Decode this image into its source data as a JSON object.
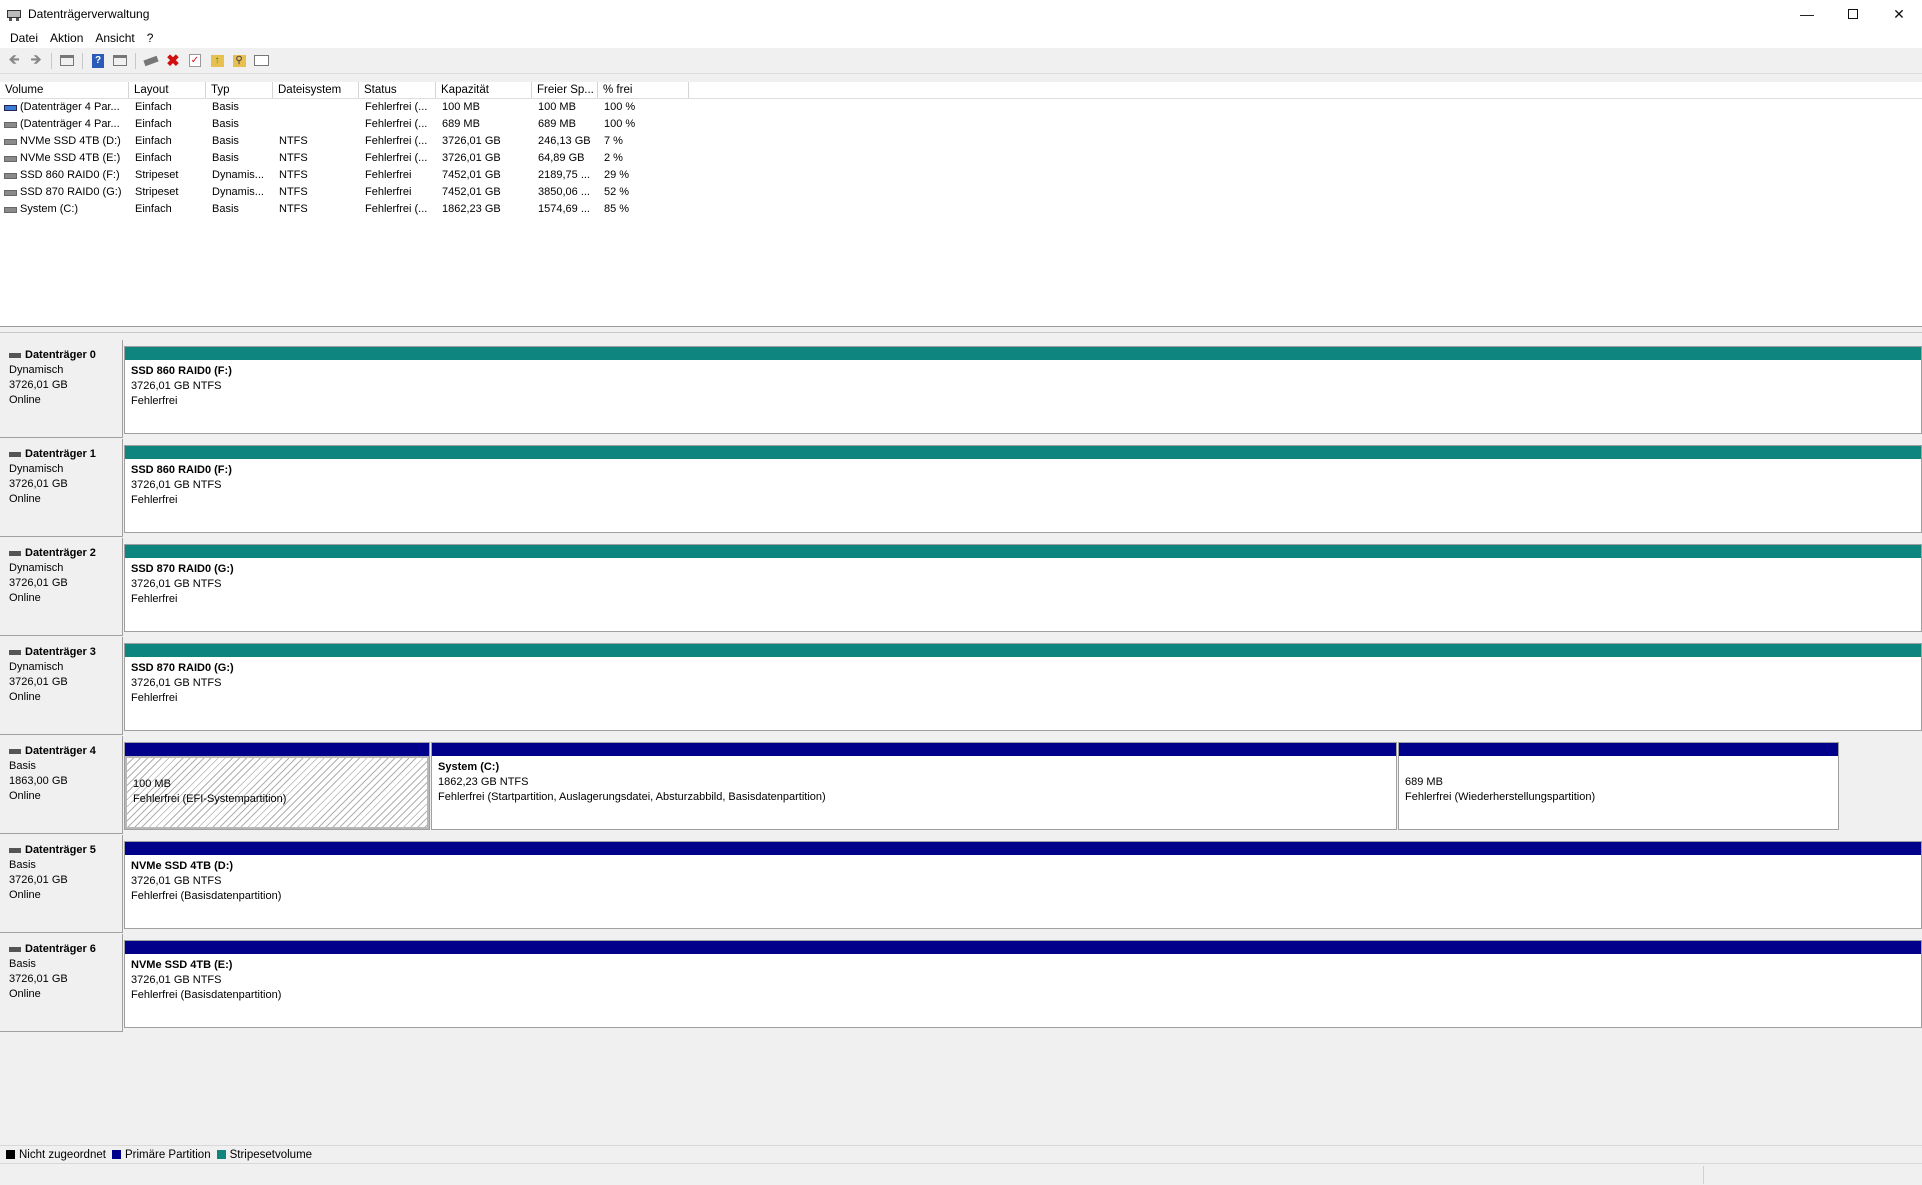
{
  "window": {
    "title": "Datenträgerverwaltung"
  },
  "menu": [
    "Datei",
    "Aktion",
    "Ansicht",
    "?"
  ],
  "toolbar_icons": [
    "back-arrow-icon",
    "forward-arrow-icon",
    "console-tree-icon",
    "help-icon",
    "properties-icon",
    "connect-disk-icon",
    "delete-icon",
    "check-icon",
    "folder-up-icon",
    "search-icon",
    "disk-list-icon"
  ],
  "volume_table": {
    "columns": [
      "Volume",
      "Layout",
      "Typ",
      "Dateisystem",
      "Status",
      "Kapazität",
      "Freier Sp...",
      "% frei"
    ],
    "rows": [
      {
        "icon": "blue",
        "cells": [
          "(Datenträger 4 Par...",
          "Einfach",
          "Basis",
          "",
          "Fehlerfrei (...",
          "100 MB",
          "100 MB",
          "100 %"
        ]
      },
      {
        "icon": "gray",
        "cells": [
          "(Datenträger 4 Par...",
          "Einfach",
          "Basis",
          "",
          "Fehlerfrei (...",
          "689 MB",
          "689 MB",
          "100 %"
        ]
      },
      {
        "icon": "gray",
        "cells": [
          "NVMe SSD 4TB (D:)",
          "Einfach",
          "Basis",
          "NTFS",
          "Fehlerfrei (...",
          "3726,01 GB",
          "246,13 GB",
          "7 %"
        ]
      },
      {
        "icon": "gray",
        "cells": [
          "NVMe SSD 4TB (E:)",
          "Einfach",
          "Basis",
          "NTFS",
          "Fehlerfrei (...",
          "3726,01 GB",
          "64,89 GB",
          "2 %"
        ]
      },
      {
        "icon": "gray",
        "cells": [
          "SSD 860 RAID0 (F:)",
          "Stripeset",
          "Dynamis...",
          "NTFS",
          "Fehlerfrei",
          "7452,01 GB",
          "2189,75 ...",
          "29 %"
        ]
      },
      {
        "icon": "gray",
        "cells": [
          "SSD 870 RAID0 (G:)",
          "Stripeset",
          "Dynamis...",
          "NTFS",
          "Fehlerfrei",
          "7452,01 GB",
          "3850,06 ...",
          "52 %"
        ]
      },
      {
        "icon": "gray",
        "cells": [
          "System (C:)",
          "Einfach",
          "Basis",
          "NTFS",
          "Fehlerfrei (...",
          "1862,23 GB",
          "1574,69 ...",
          "85 %"
        ]
      }
    ]
  },
  "disks": [
    {
      "name": "Datenträger 0",
      "type": "Dynamisch",
      "size": "3726,01 GB",
      "state": "Online",
      "partitions": [
        {
          "style": "teal",
          "label": "SSD 860 RAID0  (F:)",
          "size": "3726,01 GB NTFS",
          "status": "Fehlerfrei"
        }
      ]
    },
    {
      "name": "Datenträger 1",
      "type": "Dynamisch",
      "size": "3726,01 GB",
      "state": "Online",
      "partitions": [
        {
          "style": "teal",
          "label": "SSD 860 RAID0  (F:)",
          "size": "3726,01 GB NTFS",
          "status": "Fehlerfrei"
        }
      ]
    },
    {
      "name": "Datenträger 2",
      "type": "Dynamisch",
      "size": "3726,01 GB",
      "state": "Online",
      "partitions": [
        {
          "style": "teal",
          "label": "SSD 870 RAID0  (G:)",
          "size": "3726,01 GB NTFS",
          "status": "Fehlerfrei"
        }
      ]
    },
    {
      "name": "Datenträger 3",
      "type": "Dynamisch",
      "size": "3726,01 GB",
      "state": "Online",
      "partitions": [
        {
          "style": "teal",
          "label": "SSD 870 RAID0  (G:)",
          "size": "3726,01 GB NTFS",
          "status": "Fehlerfrei"
        }
      ]
    },
    {
      "name": "Datenträger 4",
      "type": "Basis",
      "size": "1863,00 GB",
      "state": "Online",
      "partitions": [
        {
          "style": "navy",
          "hatched": true,
          "label": "",
          "size": "100 MB",
          "status": "Fehlerfrei (EFI-Systempartition)"
        },
        {
          "style": "navy",
          "label": "System  (C:)",
          "size": "1862,23 GB NTFS",
          "status": "Fehlerfrei (Startpartition, Auslagerungsdatei, Absturzabbild, Basisdatenpartition)"
        },
        {
          "style": "navy",
          "label": "",
          "size": "689 MB",
          "status": "Fehlerfrei (Wiederherstellungspartition)"
        }
      ]
    },
    {
      "name": "Datenträger 5",
      "type": "Basis",
      "size": "3726,01 GB",
      "state": "Online",
      "partitions": [
        {
          "style": "navy",
          "label": "NVMe SSD 4TB  (D:)",
          "size": "3726,01 GB NTFS",
          "status": "Fehlerfrei (Basisdatenpartition)"
        }
      ]
    },
    {
      "name": "Datenträger 6",
      "type": "Basis",
      "size": "3726,01 GB",
      "state": "Online",
      "partitions": [
        {
          "style": "navy",
          "label": "NVMe SSD 4TB  (E:)",
          "size": "3726,01 GB NTFS",
          "status": "Fehlerfrei (Basisdatenpartition)"
        }
      ]
    }
  ],
  "legend": [
    {
      "label": "Nicht zugeordnet",
      "color": "#000000"
    },
    {
      "label": "Primäre Partition",
      "color": "#00008b"
    },
    {
      "label": "Stripesetvolume",
      "color": "#0f857f"
    }
  ],
  "colors": {
    "stripe": "#0f857f",
    "primary": "#00008b",
    "unallocated": "#000000"
  }
}
